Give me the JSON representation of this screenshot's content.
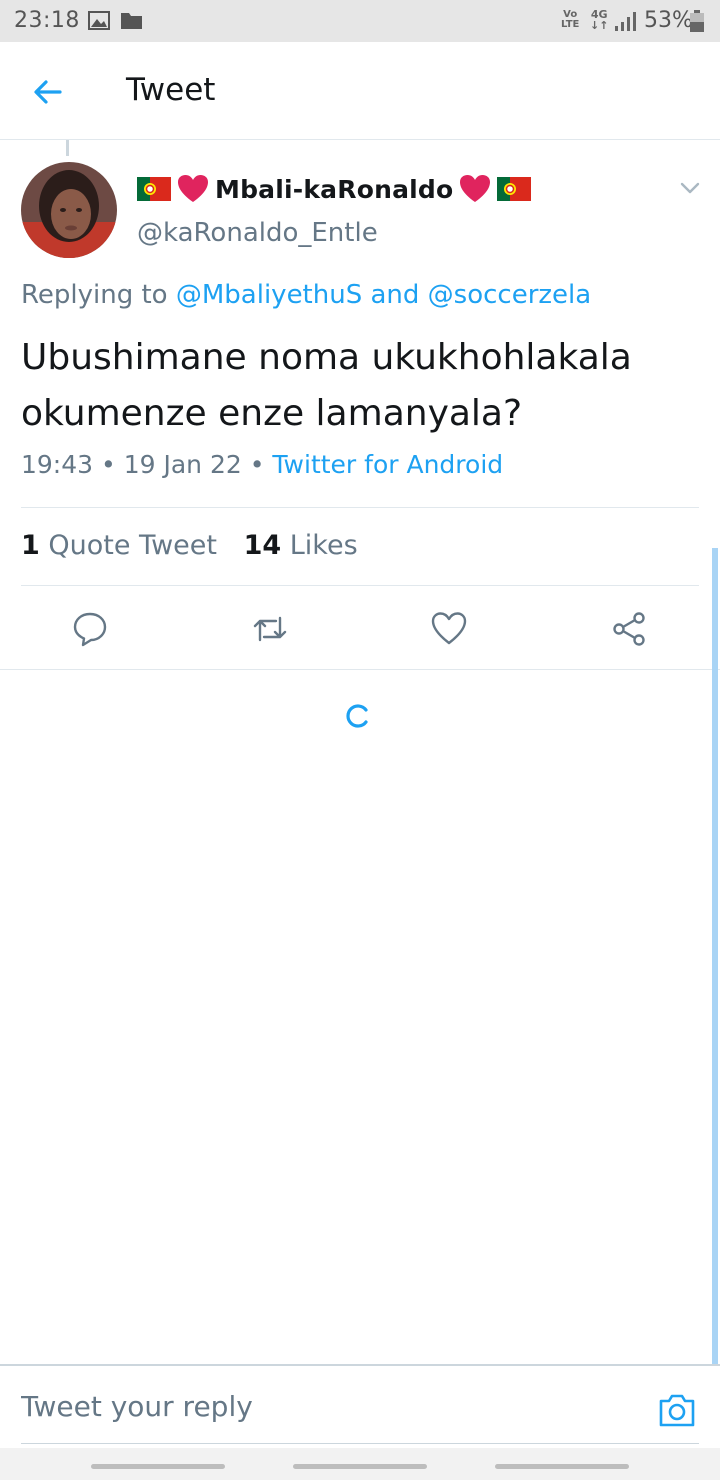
{
  "status_bar": {
    "time": "23:18",
    "volte_top": "Vo",
    "volte_bottom": "LTE",
    "network": "4G",
    "network_arrows": "↓↑",
    "battery": "53%"
  },
  "header": {
    "title": "Tweet"
  },
  "tweet": {
    "display_name": "Mbali-kaRonaldo",
    "username": "@kaRonaldo_Entle",
    "replying_prefix": "Replying to",
    "mention_1": "@MbaliyethuS",
    "replying_and": "and",
    "mention_2": "@soccerzela",
    "text": "Ubushimane noma ukukhohlakala okumenze enze lamanyala?",
    "time": "19:43",
    "dot": "•",
    "date": "19 Jan 22",
    "source": "Twitter for Android",
    "quote_count": "1",
    "quote_label": "Quote Tweet",
    "like_count": "14",
    "like_label": "Likes"
  },
  "reply": {
    "placeholder": "Tweet your reply"
  },
  "colors": {
    "accent": "#1da1f2",
    "secondary_text": "#657786",
    "heart": "#e0245e",
    "flag_green": "#046a38",
    "flag_red": "#da291c"
  },
  "icons": {
    "back": "arrow-left-icon",
    "chevron": "chevron-down-icon",
    "reply": "comment-icon",
    "retweet": "retweet-icon",
    "like": "heart-outline-icon",
    "share": "share-icon",
    "camera": "camera-icon"
  }
}
